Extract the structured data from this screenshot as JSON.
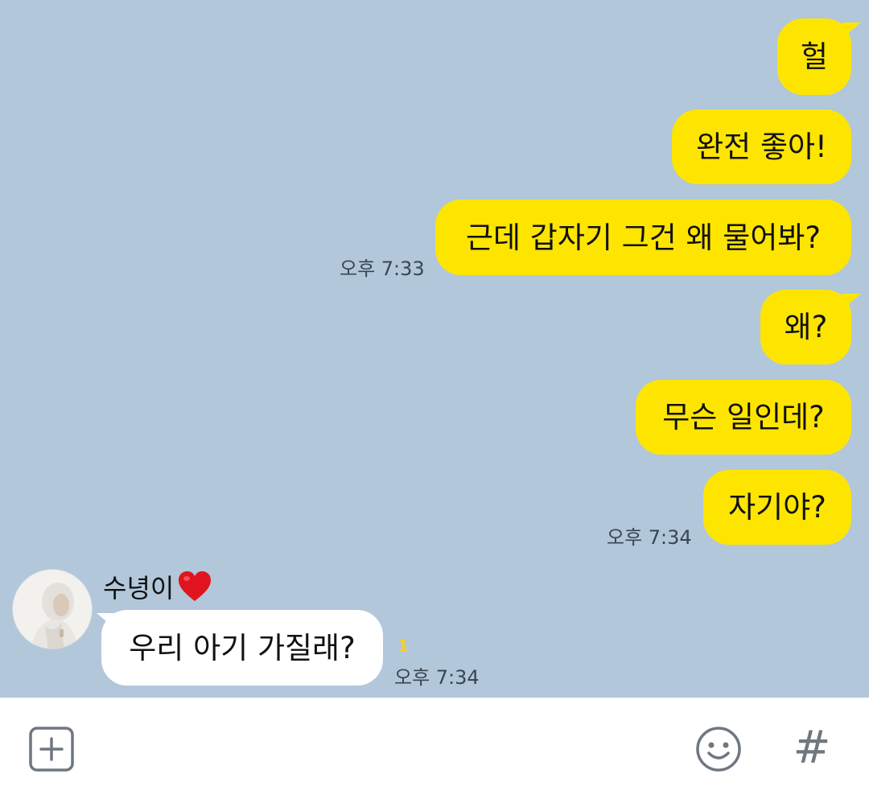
{
  "colors": {
    "chat_background": "#b2c7da",
    "outgoing_bubble": "#fee500",
    "incoming_bubble": "#ffffff",
    "unread_count": "#f2d22a"
  },
  "outgoing": [
    {
      "text": "헐"
    },
    {
      "text": "완전 좋아!"
    },
    {
      "text": "근데 갑자기 그건 왜 물어봐?",
      "time": "오후 7:33"
    },
    {
      "text": "왜?"
    },
    {
      "text": "무슨 일인데?"
    },
    {
      "text": "자기야?",
      "time": "오후 7:34"
    }
  ],
  "incoming": {
    "sender": "수녕이",
    "sender_icon": "heart-emoji",
    "text": "우리 아기 가질래?",
    "unread": "1",
    "time": "오후 7:34"
  },
  "input_bar": {
    "add_icon": "plus-square-icon",
    "emoji_icon": "smiley-icon",
    "hashtag_icon": "hashtag-icon",
    "hashtag_glyph": "#"
  }
}
